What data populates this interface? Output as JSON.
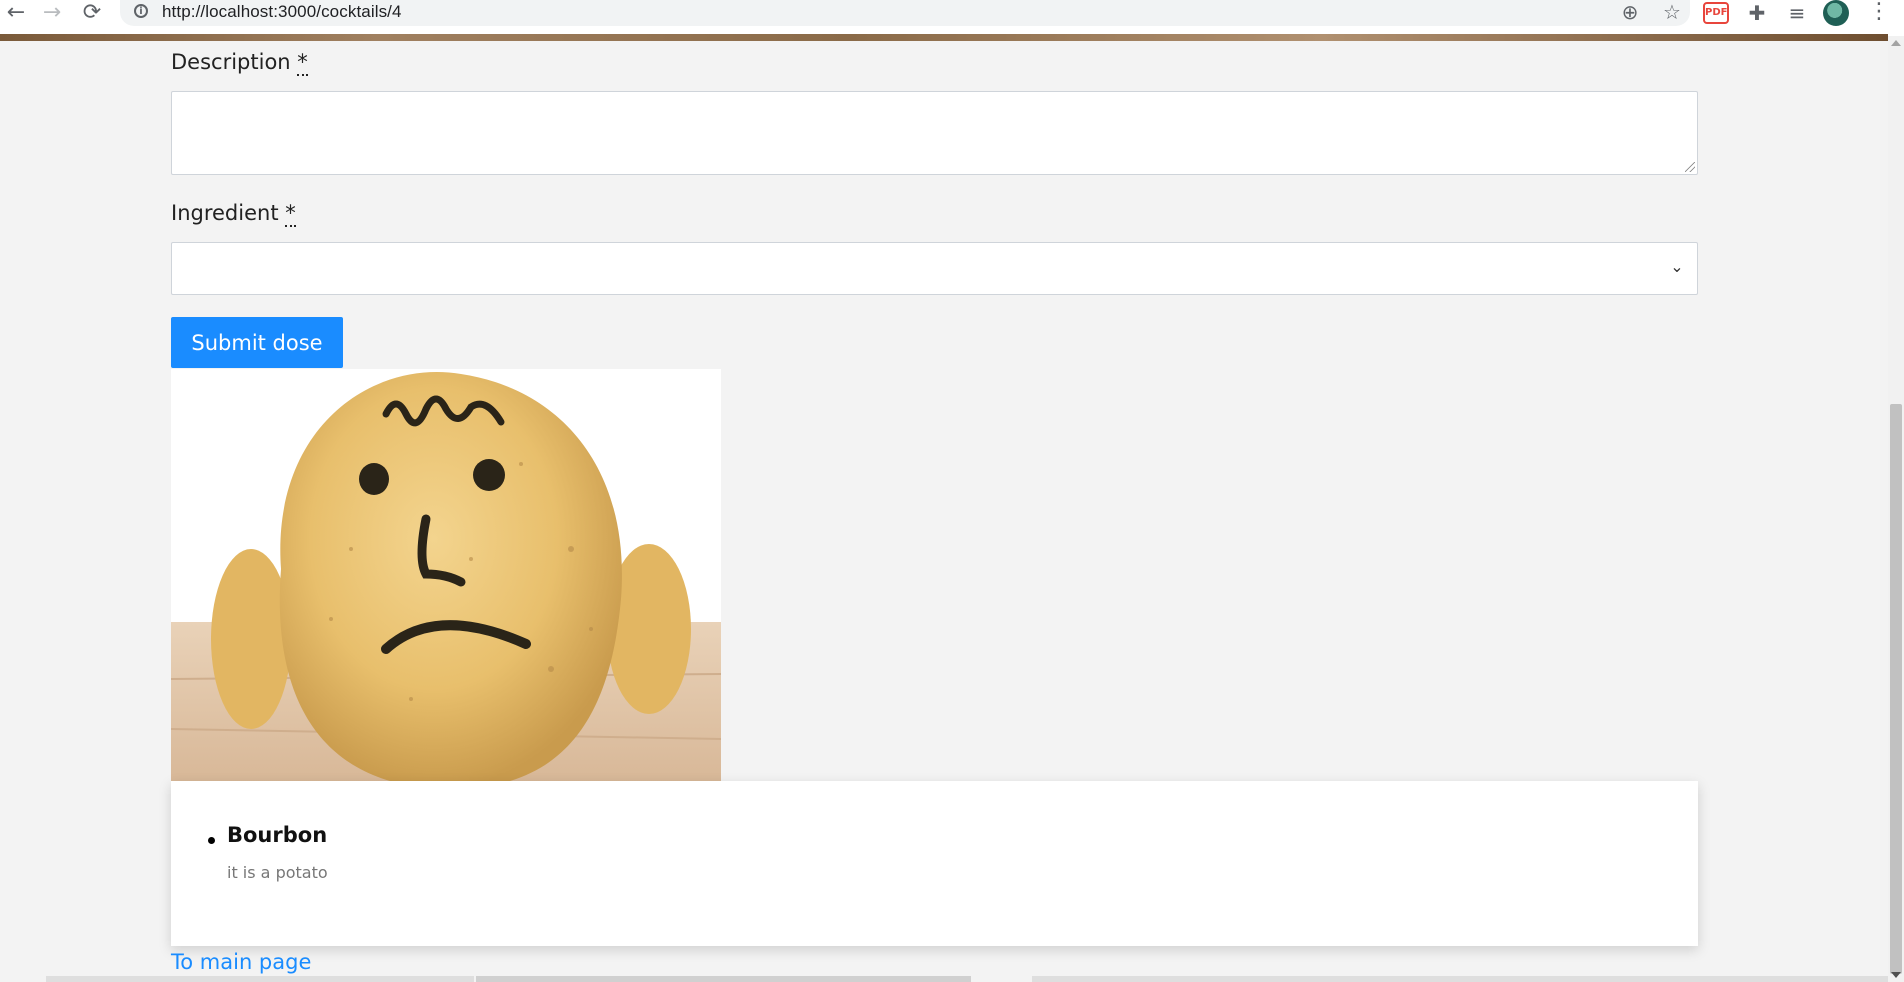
{
  "browser": {
    "back_glyph": "←",
    "forward_glyph": "→",
    "reload_glyph": "⟳",
    "info_glyph": "i",
    "url": "http://localhost:3000/cocktails/4",
    "zoom_glyph": "⊕",
    "star_glyph": "☆",
    "extensions_glyph": "✚",
    "media_glyph": "≡",
    "menu_glyph": "⋮",
    "pdf_ext_glyph": "PDF",
    "icons": [
      "back-icon",
      "forward-icon",
      "reload-icon",
      "info-icon",
      "zoom-icon",
      "bookmark-star-icon",
      "pdf-extension-icon",
      "puzzle-extensions-icon",
      "media-queue-icon",
      "profile-avatar",
      "kebab-menu-icon"
    ]
  },
  "form": {
    "description_label": "Description",
    "description_required_mark": "*",
    "description_value": "",
    "ingredient_label": "Ingredient",
    "ingredient_required_mark": "*",
    "ingredient_selected": "",
    "select_caret_glyph": "⌄",
    "submit_label": "Submit dose"
  },
  "doses": [
    {
      "ingredient": "Bourbon",
      "description": "it is a potato"
    }
  ],
  "footer": {
    "main_page_link": "To main page"
  },
  "colors": {
    "accent": "#1a8cff",
    "page_bg": "#f3f3f3",
    "card_bg": "#ffffff"
  }
}
